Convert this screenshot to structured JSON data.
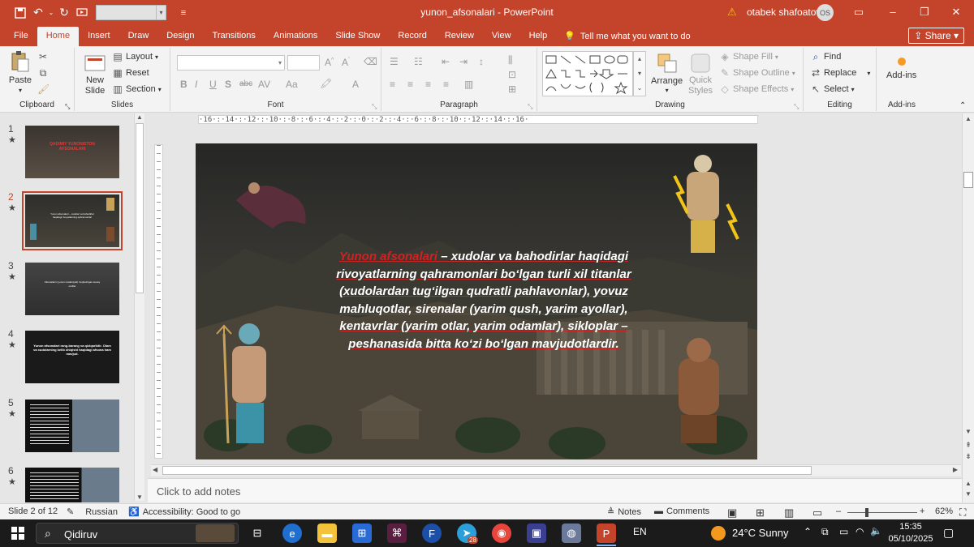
{
  "window": {
    "doc_title": "yunon_afsonalari - PowerPoint",
    "user_name": "otabek shafoatov",
    "user_initials": "OS",
    "accent": "#c4432b"
  },
  "tabs": [
    "File",
    "Home",
    "Insert",
    "Draw",
    "Design",
    "Transitions",
    "Animations",
    "Slide Show",
    "Record",
    "Review",
    "View",
    "Help"
  ],
  "active_tab": "Home",
  "tell_me": "Tell me what you want to do",
  "share_label": "Share",
  "ribbon": {
    "clipboard": {
      "paste": "Paste",
      "label": "Clipboard"
    },
    "slides": {
      "new_slide_1": "New",
      "new_slide_2": "Slide",
      "layout": "Layout",
      "reset": "Reset",
      "section": "Section",
      "label": "Slides"
    },
    "font": {
      "label": "Font",
      "bold": "B",
      "italic": "I",
      "underline": "U",
      "shadow": "S",
      "strike": "abc",
      "spacing": "AV",
      "case": "Aa",
      "grow": "A",
      "color": "A"
    },
    "paragraph": {
      "label": "Paragraph"
    },
    "drawing": {
      "arrange": "Arrange",
      "quick_styles_1": "Quick",
      "quick_styles_2": "Styles",
      "shape_fill": "Shape Fill",
      "shape_outline": "Shape Outline",
      "shape_effects": "Shape Effects",
      "label": "Drawing"
    },
    "editing": {
      "find": "Find",
      "replace": "Replace",
      "select": "Select",
      "label": "Editing"
    },
    "addins": {
      "btn": "Add-ins",
      "label": "Add-ins"
    }
  },
  "thumbnails": [
    {
      "num": "1",
      "text": "QADIMIY YUNONISTON AFSONALARI"
    },
    {
      "num": "2",
      "text": "Yunon afsonalari – xudolar va bahodirlar haqidagi rivoyatlarning qahramonlari"
    },
    {
      "num": "3",
      "text": "Afsonalarni (yunon madaniyati) rivojlantirgan asosiy omillar"
    },
    {
      "num": "4",
      "text": "Yunon afsonalari rang-barang va qiziqarlidir. Olam va xudolarning kelib chiqishi haqidagi afsona ham mavjud."
    },
    {
      "num": "5",
      "text": ""
    },
    {
      "num": "6",
      "text": ""
    }
  ],
  "ruler_text": "·16·:·14·:·12·:·10·:·8·:·6·:·4·:·2·:·0·:·2·:·4·:·6·:·8·:·10·:·12·:·14·:·16·",
  "slide": {
    "text_red": "Yunon afsonalari",
    "text_rest": " – xudolar va bahodirlar haqidagi rivoyatlarning qahramonlari bo‘lgan turli xil titanlar (xudolardan tug‘ilgan qudratli pahlavonlar), yovuz mahluqotlar, sirenalar (yarim qush, yarim ayollar), kentavrlar (yarim otlar, yarim odamlar), sikloplar – peshanasida bitta ko‘zi bo‘lgan  mavjudotlardir."
  },
  "notes_placeholder": "Click to add notes",
  "status": {
    "slide_count": "Slide 2 of 12",
    "language": "Russian",
    "accessibility": "Accessibility: Good to go",
    "notes": "Notes",
    "comments": "Comments",
    "zoom": "62%"
  },
  "taskbar": {
    "search": "Qidiruv",
    "lang": "EN",
    "weather": "24°C  Sunny",
    "time": "15:35",
    "date": "05/10/2025",
    "telegram_badge": "28"
  }
}
